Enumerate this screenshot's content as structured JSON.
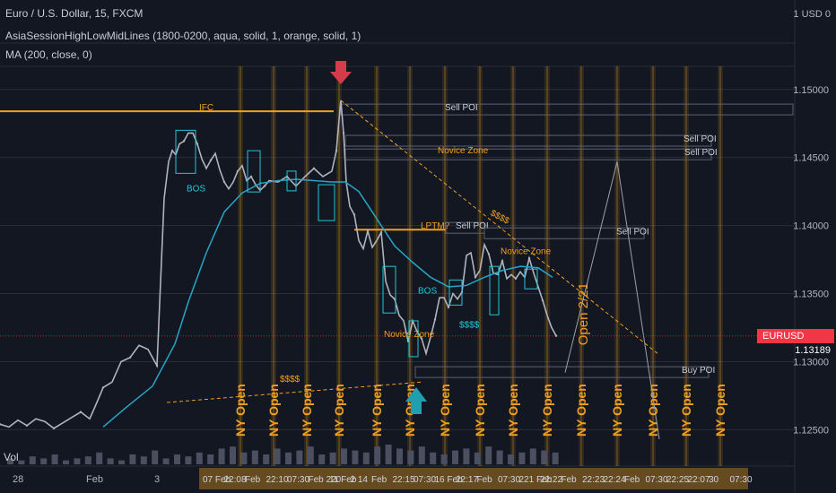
{
  "header": {
    "symbol_line": "Euro / U.S. Dollar, 15, FXCM",
    "indicator_line": "AsiaSessionHighLowMidLines (1800-0200, aqua, solid, 1, orange, solid, 1)",
    "ma_line": "MA (200, close, 0)",
    "currency_label": "1 USD 0"
  },
  "price_tag": {
    "label": "EURUSD",
    "value": "1.13189",
    "color": "#f23645"
  },
  "colors": {
    "background": "#131722",
    "grid": "#2a2e39",
    "up_candle": "#9aa0ac",
    "ma_line": "#26a5c7",
    "session_line": "#f0a020",
    "box_outline": "#22c7d8",
    "label_dark": "#9aa0ac",
    "label_orange": "#f0a020",
    "arrow_down": "#d43b4b",
    "arrow_up": "#1f9fb0",
    "volume": "#4b5060"
  },
  "chart_data": {
    "type": "line",
    "title": "",
    "xlabel": "",
    "ylabel": "",
    "ylim": [
      1.1243,
      1.1517
    ],
    "yticks": [
      "1.15000",
      "1.14500",
      "1.14000",
      "1.13500",
      "1.13000",
      "1.12500"
    ],
    "ytick_values": [
      1.15,
      1.145,
      1.14,
      1.135,
      1.13,
      1.125
    ],
    "x_ticks": [
      "28",
      "Feb",
      "3"
    ],
    "x_overlay_labels": [
      "07 Feb",
      "22:08",
      "Feb",
      "22:10",
      "07:30",
      "Feb 220",
      "11 Feb",
      "2 14",
      "Feb",
      "22:15",
      "07:30",
      "16 Feb",
      "22:17",
      "Feb",
      "07:30",
      "221 Feb",
      "22:22",
      "Feb",
      "22:23",
      "22:24",
      "Feb",
      "07:30",
      "22:25",
      "22:07",
      "30",
      "07:30"
    ],
    "series": [
      {
        "name": "EURUSD",
        "x": [
          0,
          10,
          20,
          30,
          40,
          50,
          60,
          70,
          80,
          90,
          100,
          108,
          115,
          125,
          135,
          145,
          155,
          165,
          175,
          183,
          188,
          192,
          196,
          200,
          205,
          210,
          215,
          220,
          225,
          230,
          235,
          240,
          245,
          250,
          255,
          260,
          265,
          270,
          275,
          280,
          285,
          290,
          295,
          300,
          310,
          320,
          330,
          340,
          350,
          360,
          370,
          375,
          378,
          380,
          383,
          386,
          390,
          395,
          400,
          405,
          410,
          415,
          420,
          425,
          430,
          435,
          440,
          445,
          450,
          455,
          460,
          465,
          470,
          475,
          480,
          485,
          490,
          495,
          500,
          505,
          510,
          515,
          520,
          525,
          530,
          535,
          540,
          545,
          550,
          555,
          560,
          565,
          570,
          575,
          580,
          585,
          590,
          595,
          600,
          605,
          610,
          615,
          620
        ],
        "values": [
          1.1254,
          1.1252,
          1.1257,
          1.1253,
          1.1258,
          1.1256,
          1.1251,
          1.1255,
          1.1259,
          1.1263,
          1.1258,
          1.127,
          1.1281,
          1.1285,
          1.13,
          1.1303,
          1.1312,
          1.1309,
          1.1297,
          1.142,
          1.1447,
          1.1455,
          1.1452,
          1.146,
          1.1462,
          1.1468,
          1.1468,
          1.146,
          1.1449,
          1.1442,
          1.1448,
          1.1453,
          1.1441,
          1.1432,
          1.1427,
          1.1432,
          1.144,
          1.1444,
          1.1433,
          1.1436,
          1.143,
          1.1426,
          1.1429,
          1.1433,
          1.1432,
          1.1436,
          1.1429,
          1.1436,
          1.1442,
          1.1436,
          1.144,
          1.1455,
          1.1478,
          1.1492,
          1.1468,
          1.1432,
          1.1414,
          1.1408,
          1.1389,
          1.1383,
          1.1396,
          1.1384,
          1.1389,
          1.1395,
          1.1359,
          1.1349,
          1.1346,
          1.1334,
          1.133,
          1.1315,
          1.133,
          1.1322,
          1.1317,
          1.1306,
          1.1318,
          1.1331,
          1.1347,
          1.1347,
          1.134,
          1.135,
          1.1346,
          1.1351,
          1.1378,
          1.138,
          1.1362,
          1.1367,
          1.1386,
          1.1379,
          1.1365,
          1.1364,
          1.1374,
          1.1361,
          1.1364,
          1.1361,
          1.1366,
          1.1362,
          1.1376,
          1.1365,
          1.1355,
          1.1345,
          1.1334,
          1.1325,
          1.1319
        ]
      },
      {
        "name": "MA (200, close, 0)",
        "x": [
          115,
          140,
          170,
          195,
          210,
          230,
          250,
          270,
          290,
          310,
          330,
          350,
          370,
          385,
          400,
          420,
          440,
          460,
          480,
          500,
          520,
          540,
          560,
          580,
          600,
          616
        ],
        "values": [
          1.1252,
          1.1266,
          1.1282,
          1.1313,
          1.1344,
          1.138,
          1.141,
          1.1424,
          1.1431,
          1.1433,
          1.1434,
          1.1433,
          1.1432,
          1.1432,
          1.1425,
          1.1405,
          1.1385,
          1.1373,
          1.1362,
          1.1355,
          1.1356,
          1.1362,
          1.1367,
          1.137,
          1.1369,
          1.1362
        ]
      }
    ],
    "volume": [
      3,
      2,
      4,
      3,
      5,
      2,
      3,
      4,
      6,
      3,
      2,
      5,
      4,
      7,
      3,
      5,
      4,
      6,
      5,
      8,
      9,
      6,
      7,
      5,
      8,
      6,
      7,
      9,
      5,
      6,
      8,
      7,
      6,
      9,
      10,
      8,
      7,
      9,
      6,
      5,
      7,
      8,
      6,
      9,
      7,
      5,
      6,
      8,
      7,
      6
    ],
    "levels": [
      {
        "label": "IFC",
        "value": 1.1484,
        "x_start": 0,
        "x_end": 372,
        "color": "#f0a020",
        "label_x": 222
      },
      {
        "label": "Sell POI",
        "value": 1.1484,
        "x_start": 380,
        "x_end": 884,
        "color": "#2a2e39",
        "label_x": 496
      },
      {
        "label": "Sell POI",
        "value": 1.1461,
        "x_start": 385,
        "x_end": 793,
        "color": "#2a2e39",
        "label_x": 762
      },
      {
        "label": "Sell POI",
        "value": 1.1451,
        "x_start": 385,
        "x_end": 793,
        "color": "#2a2e39",
        "label_x": 763
      },
      {
        "label": "LPTM?",
        "value": 1.1397,
        "x_start": 395,
        "x_end": 497,
        "color": "#f0a020",
        "label_x": 469
      },
      {
        "label": "Sell POI",
        "value": 1.1397,
        "x_start": 497,
        "x_end": 540,
        "color": "#2a2e39",
        "label_x": 508
      },
      {
        "label": "Sell POI",
        "value": 1.1393,
        "x_start": 540,
        "x_end": 718,
        "color": "#2a2e39",
        "label_x": 687
      },
      {
        "label": "Buy POI",
        "value": 1.1291,
        "x_start": 463,
        "x_end": 790,
        "color": "#2a2e39",
        "label_x": 760
      }
    ],
    "annotations": [
      {
        "text": "BOS",
        "x": 208,
        "y": 1.1425,
        "color": "#22c7d8"
      },
      {
        "text": "$$$$",
        "x": 546,
        "y": 1.1408,
        "color": "#f0a020",
        "rotate": 28
      },
      {
        "text": "Novice Zone",
        "x": 488,
        "y": 1.1453,
        "color": "#f0a020"
      },
      {
        "text": "Novice Zone",
        "x": 558,
        "y": 1.1379,
        "color": "#f0a020"
      },
      {
        "text": "BOS",
        "x": 466,
        "y": 1.135,
        "color": "#22c7d8"
      },
      {
        "text": "$$$$",
        "x": 512,
        "y": 1.1325,
        "color": "#22c7d8"
      },
      {
        "text": "Novice Zone",
        "x": 428,
        "y": 1.1318,
        "color": "#f0a020"
      },
      {
        "text": "$$$$",
        "x": 312,
        "y": 1.1285,
        "color": "#f0a020"
      },
      {
        "text": "Open 2/21",
        "x": 655,
        "y": 1.1312,
        "color": "#f0a020",
        "rotate": -90,
        "size": 15
      }
    ],
    "session_columns": [
      {
        "label": "NY Open",
        "x": 268
      },
      {
        "label": "NY Open",
        "x": 305
      },
      {
        "label": "NY Open",
        "x": 342
      },
      {
        "label": "NY Open",
        "x": 378
      },
      {
        "label": "NY Open",
        "x": 420
      },
      {
        "label": "NY Open",
        "x": 457
      },
      {
        "label": "NY Open",
        "x": 496
      },
      {
        "label": "NY Open",
        "x": 535
      },
      {
        "label": "NY Open",
        "x": 572
      },
      {
        "label": "NY Open",
        "x": 610
      },
      {
        "label": "NY Open",
        "x": 648
      },
      {
        "label": "NY Open",
        "x": 688
      },
      {
        "label": "NY Open",
        "x": 728
      },
      {
        "label": "NY Open",
        "x": 765
      },
      {
        "label": "NY Open",
        "x": 803
      }
    ]
  }
}
